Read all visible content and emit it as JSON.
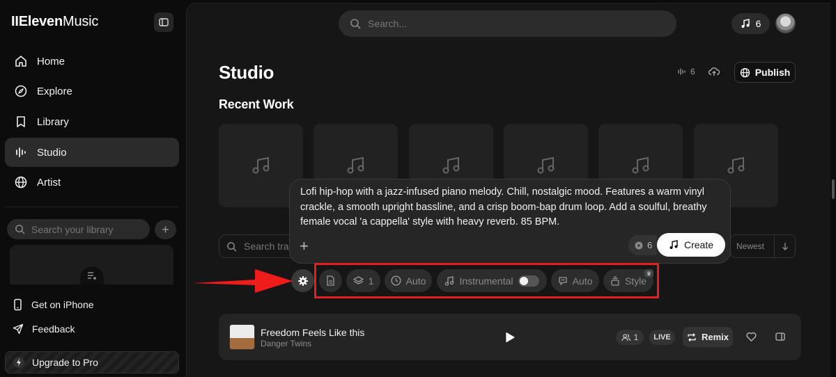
{
  "app": {
    "name_bold": "IIEleven",
    "name_rest": "Music"
  },
  "sidebar": {
    "items": [
      {
        "label": "Home",
        "icon": "home-icon"
      },
      {
        "label": "Explore",
        "icon": "compass-icon"
      },
      {
        "label": "Library",
        "icon": "bookmark-icon"
      },
      {
        "label": "Studio",
        "icon": "studio-icon",
        "active": true
      },
      {
        "label": "Artist",
        "icon": "globe-icon"
      }
    ],
    "library_search_placeholder": "Search your library",
    "get_iphone": "Get on iPhone",
    "feedback": "Feedback",
    "upgrade": "Upgrade to Pro"
  },
  "header": {
    "search_placeholder": "Search...",
    "credits": "6"
  },
  "studio": {
    "title": "Studio",
    "stat_count": "6",
    "publish_label": "Publish",
    "recent_heading": "Recent Work",
    "tracks_search_placeholder": "Search tra",
    "sort_label": "Newest"
  },
  "prompt": {
    "text": "Lofi hip-hop with a jazz-infused piano melody. Chill, nostalgic mood. Features a warm vinyl crackle, a smooth upright bassline, and a crisp boom-bap drum loop. Add a soulful, breathy female vocal 'a cappella' style with heavy reverb. 85 BPM.",
    "cost": "6",
    "create_label": "Create"
  },
  "options": {
    "layers": "1",
    "duration": "Auto",
    "instrumental": "Instrumental",
    "instrumental_on": false,
    "lyrics": "Auto",
    "style": "Style"
  },
  "song": {
    "title": "Freedom Feels Like this",
    "artist": "Danger Twins",
    "listeners": "1",
    "live": "LIVE",
    "remix_label": "Remix"
  },
  "colors": {
    "accent_red": "#e41f1f",
    "background": "#161616"
  }
}
